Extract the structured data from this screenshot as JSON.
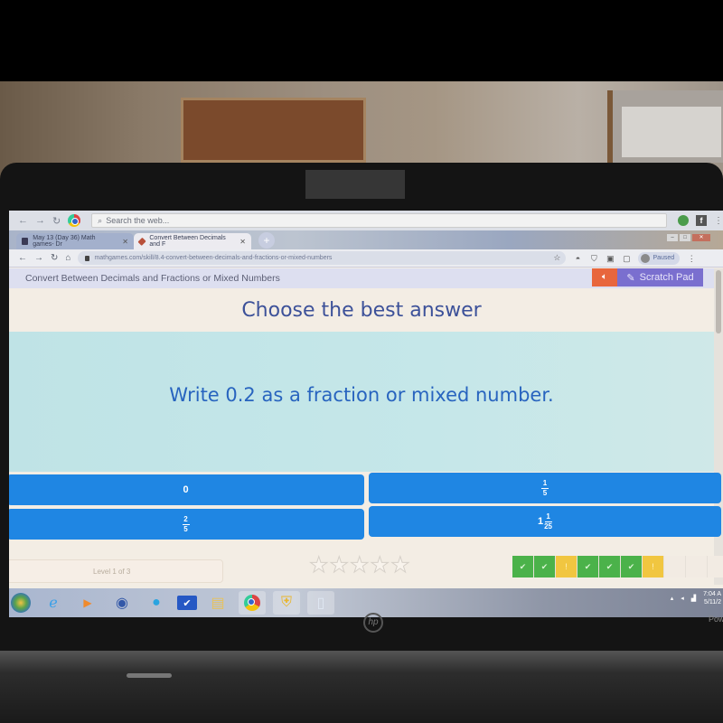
{
  "browser": {
    "search_placeholder": "Search the web...",
    "tabs": [
      {
        "label": "May 13 (Day 36) Math games- Dr",
        "active": false
      },
      {
        "label": "Convert Between Decimals and F",
        "active": true
      }
    ],
    "new_tab": "+",
    "url": "mathgames.com/skill/8.4-convert-between-decimals-and-fractions-or-mixed-numbers",
    "profile_label": "Paused",
    "window_controls": {
      "minimize": "–",
      "maximize": "□",
      "close": "✕"
    }
  },
  "page": {
    "skill_title": "Convert Between Decimals and Fractions or Mixed Numbers",
    "audio_icon": "speaker-icon",
    "scratch_pad_label": "Scratch Pad",
    "prompt": "Choose the best answer",
    "question": "Write 0.2 as a fraction or mixed number.",
    "answers": [
      {
        "type": "whole",
        "whole": "0"
      },
      {
        "type": "fraction",
        "numerator": "1",
        "denominator": "5"
      },
      {
        "type": "fraction",
        "numerator": "2",
        "denominator": "5"
      },
      {
        "type": "mixed",
        "whole": "1",
        "numerator": "1",
        "denominator": "25"
      }
    ],
    "level_label": "Level 1 of 3",
    "stars_earned": 0,
    "stars_total": 5,
    "progress_tiles": [
      "correct",
      "correct",
      "incorrect",
      "correct",
      "correct",
      "correct",
      "incorrect",
      "empty",
      "empty",
      "empty"
    ],
    "tile_symbols": {
      "correct": "✔",
      "incorrect": "!",
      "empty": ""
    }
  },
  "taskbar": {
    "apps": [
      "internet-explorer",
      "media-player",
      "itunes",
      "cortana-app",
      "checkmark-app",
      "file-explorer",
      "chrome",
      "windows-update",
      "notepad"
    ],
    "time": "7:04 A",
    "date": "5/11/2"
  },
  "laptop": {
    "brand": "hp",
    "side_text": "Pow"
  }
}
